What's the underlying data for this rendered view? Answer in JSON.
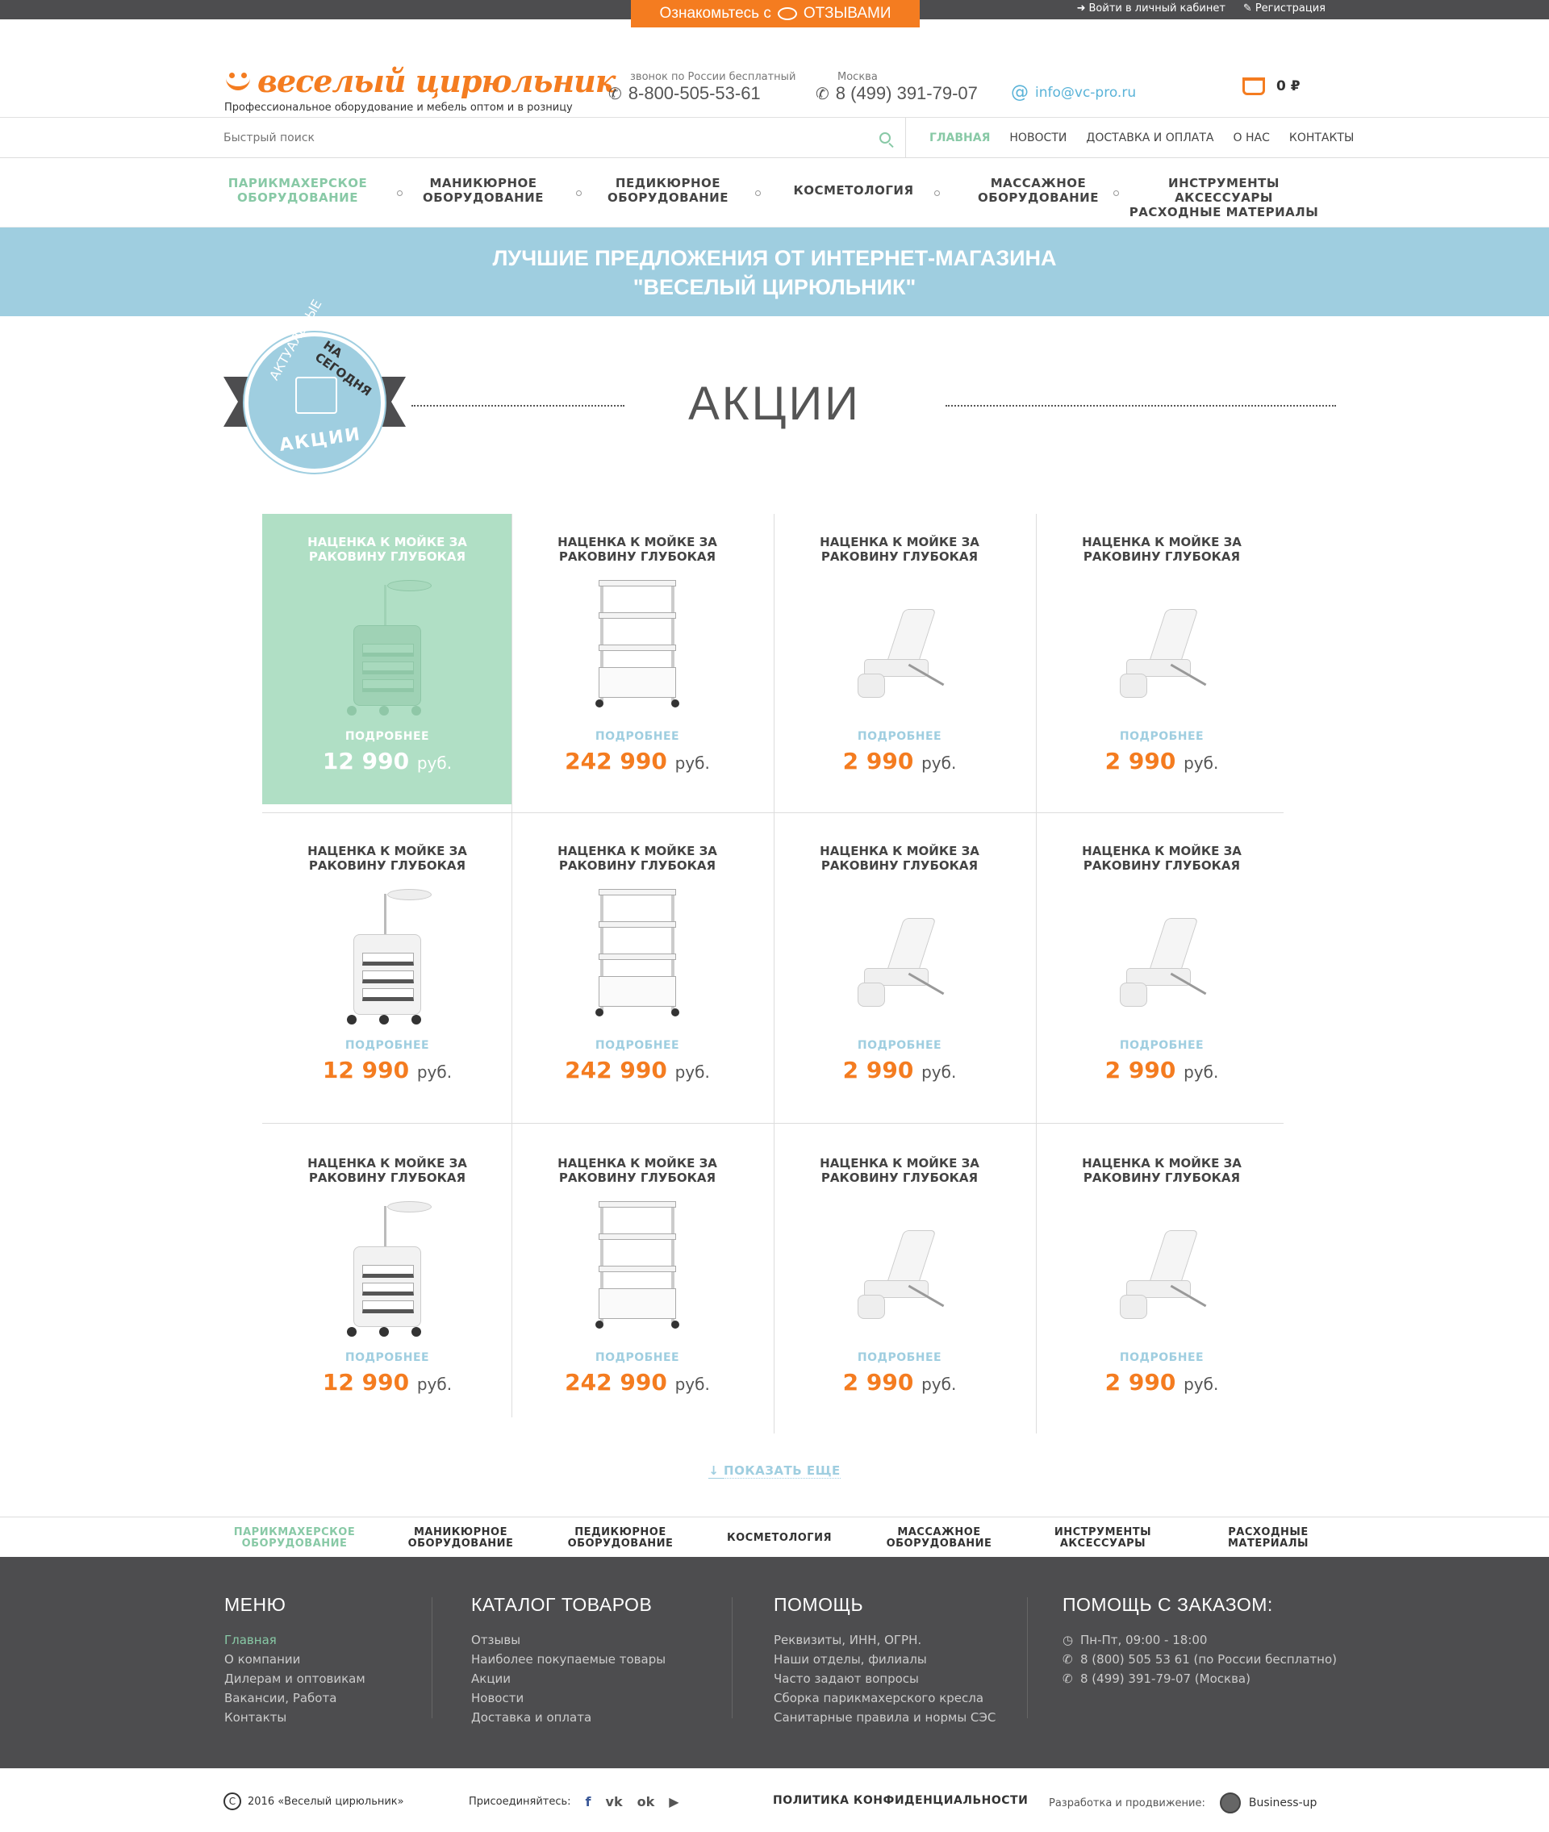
{
  "topbar": {
    "promo_prefix": "Ознакомьтесь с",
    "promo_accent": "ОТЗЫВАМИ",
    "login": "Войти в личный кабинет",
    "register": "Регистрация"
  },
  "header": {
    "logo": "веселый цирюльник",
    "tagline": "Профессиональное оборудование и мебель оптом и в розницу",
    "phone1_label": "звонок по России бесплатный",
    "phone1": "8-800-505-53-61",
    "phone2_label": "Москва",
    "phone2": "8 (499) 391-79-07",
    "email": "info@vc-pro.ru",
    "cart": "0 ₽"
  },
  "search": {
    "placeholder": "Быстрый поиск"
  },
  "mainnav": [
    "ГЛАВНАЯ",
    "НОВОСТИ",
    "ДОСТАВКА И ОПЛАТА",
    "О НАС",
    "КОНТАКТЫ"
  ],
  "categories": [
    [
      "ПАРИКМАХЕРСКОЕ",
      "ОБОРУДОВАНИЕ"
    ],
    [
      "МАНИКЮРНОЕ",
      "ОБОРУДОВАНИЕ"
    ],
    [
      "ПЕДИКЮРНОЕ",
      "ОБОРУДОВАНИЕ"
    ],
    [
      "КОСМЕТОЛОГИЯ",
      ""
    ],
    [
      "МАССАЖНОЕ",
      "ОБОРУДОВАНИЕ"
    ],
    [
      "ИНСТРУМЕНТЫ АКСЕССУАРЫ",
      "РАСХОДНЫЕ МАТЕРИАЛЫ"
    ]
  ],
  "banner": {
    "line1": "ЛУЧШИЕ ПРЕДЛОЖЕНИЯ ОТ ИНТЕРНЕТ-МАГАЗИНА",
    "line2": "\"ВЕСЕЛЫЙ ЦИРЮЛЬНИК\""
  },
  "sale": {
    "title": "АКЦИИ",
    "badge_top": "АКТУАЛЬНЫЕ",
    "badge_mid": "НА СЕГОДНЯ",
    "badge_bottom": "АКЦИИ"
  },
  "product": {
    "name1": "НАЦЕНКА К МОЙКЕ ЗА",
    "name2": "РАКОВИНУ ГЛУБОКАЯ",
    "more": "ПОДРОБНЕЕ",
    "currency": "руб."
  },
  "products": [
    {
      "type": "cabinet",
      "price": "12 990"
    },
    {
      "type": "rack",
      "price": "242 990"
    },
    {
      "type": "chair",
      "price": "2 990"
    },
    {
      "type": "chair",
      "price": "2 990"
    },
    {
      "type": "cabinet",
      "price": "12 990"
    },
    {
      "type": "rack",
      "price": "242 990"
    },
    {
      "type": "chair",
      "price": "2 990"
    },
    {
      "type": "chair",
      "price": "2 990"
    },
    {
      "type": "cabinet",
      "price": "12 990"
    },
    {
      "type": "rack",
      "price": "242 990"
    },
    {
      "type": "chair",
      "price": "2 990"
    },
    {
      "type": "chair",
      "price": "2 990"
    }
  ],
  "show_more": "ПОКАЗАТЬ ЕЩЕ",
  "catnav2": [
    [
      "ПАРИКМАХЕРСКОЕ",
      "ОБОРУДОВАНИЕ"
    ],
    [
      "МАНИКЮРНОЕ",
      "ОБОРУДОВАНИЕ"
    ],
    [
      "ПЕДИКЮРНОЕ",
      "ОБОРУДОВАНИЕ"
    ],
    [
      "КОСМЕТОЛОГИЯ",
      ""
    ],
    [
      "МАССАЖНОЕ",
      "ОБОРУДОВАНИЕ"
    ],
    [
      "ИНСТРУМЕНТЫ",
      "АКСЕССУАРЫ"
    ],
    [
      "РАСХОДНЫЕ",
      "МАТЕРИАЛЫ"
    ]
  ],
  "footer": {
    "menu": {
      "title": "МЕНЮ",
      "items": [
        "Главная",
        "О компании",
        "Дилерам и оптовикам",
        "Вакансии, Работа",
        "Контакты"
      ]
    },
    "catalog": {
      "title": "КАТАЛОГ ТОВАРОВ",
      "items": [
        "Отзывы",
        "Наиболее покупаемые товары",
        "Акции",
        "Новости",
        "Доставка и оплата"
      ]
    },
    "help": {
      "title": "ПОМОЩЬ",
      "items": [
        "Реквизиты, ИНН, ОГРН.",
        "Наши отделы, филиалы",
        "Часто задают вопросы",
        "Сборка парикмахерского кресла",
        "Санитарные правила и нормы СЭС"
      ]
    },
    "order": {
      "title": "ПОМОЩЬ С ЗАКАЗОМ:",
      "hours": "Пн-Пт, 09:00 - 18:00",
      "phone1": "8 (800) 505 53 61 (по России бесплатно)",
      "phone2": "8 (499) 391-79-07 (Москва)"
    }
  },
  "bottom": {
    "copyright": "2016 «Веселый цирюльник»",
    "join": "Присоединяйтесь:",
    "policy": "ПОЛИТИКА КОНФИДЕНЦИАЛЬНОСТИ",
    "dev_label": "Разработка и продвижение:",
    "dev_name": "Business-up"
  }
}
